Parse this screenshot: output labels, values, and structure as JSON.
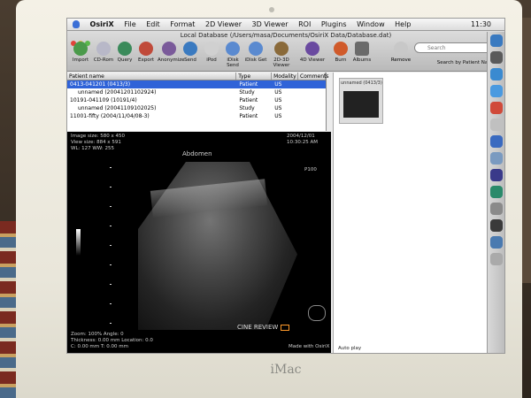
{
  "device": {
    "brand": "iMac"
  },
  "menubar": {
    "app_name": "OsiriX",
    "items": [
      "File",
      "Edit",
      "Format",
      "2D Viewer",
      "3D Viewer",
      "ROI",
      "Plugins",
      "Window",
      "Help"
    ],
    "clock": "11:30"
  },
  "window": {
    "title": "Local Database (/Users/masa/Documents/OsiriX Data/Database.dat)"
  },
  "toolbar": {
    "items": [
      "Import",
      "CD-Rom",
      "Query",
      "Export",
      "Anonymize",
      "Send",
      "iPod",
      "iDisk Send",
      "iDisk Get",
      "2D-3D Viewer",
      "4D Viewer",
      "Burn",
      "Albums"
    ],
    "remove_label": "Remove",
    "search_placeholder": "Search",
    "search_caption": "Search by Patient Name"
  },
  "database": {
    "columns": [
      "Patient name",
      "Type",
      "Modality",
      "Comments"
    ],
    "rows": [
      {
        "name": "0413-041201 (0413/3)",
        "type": "Patient",
        "modality": "US",
        "selected": true
      },
      {
        "name": "unnamed (20041201102924)",
        "type": "Study",
        "modality": "US",
        "selected": false
      },
      {
        "name": "10191-041109 (10191/4)",
        "type": "Patient",
        "modality": "US",
        "selected": false
      },
      {
        "name": "unnamed (20041109102025)",
        "type": "Study",
        "modality": "US",
        "selected": false
      },
      {
        "name": "11001-fifty (2004/11/04/08-3)",
        "type": "Patient",
        "modality": "US",
        "selected": false
      }
    ]
  },
  "preview": {
    "thumb_caption": "unnamed (0413/3)"
  },
  "viewer": {
    "image_size": "Image size: 580 x 450",
    "view_size": "View size: 884 x 591",
    "wl_value": "WL: 127 WW: 255",
    "region_label": "Abdomen",
    "date": "2004/12/01",
    "time": "10:30:25 AM",
    "probe_label": "P100",
    "zoom": "Zoom: 100% Angle: 0",
    "thickness": "Thickness: 0.00 mm Location: 0.0",
    "pixel": "C: 0.00 mm T: 0.00 mm",
    "cine_label": "CINE REVIEW",
    "made_with": "Made with OsiriX",
    "auto_play": "Auto play"
  }
}
